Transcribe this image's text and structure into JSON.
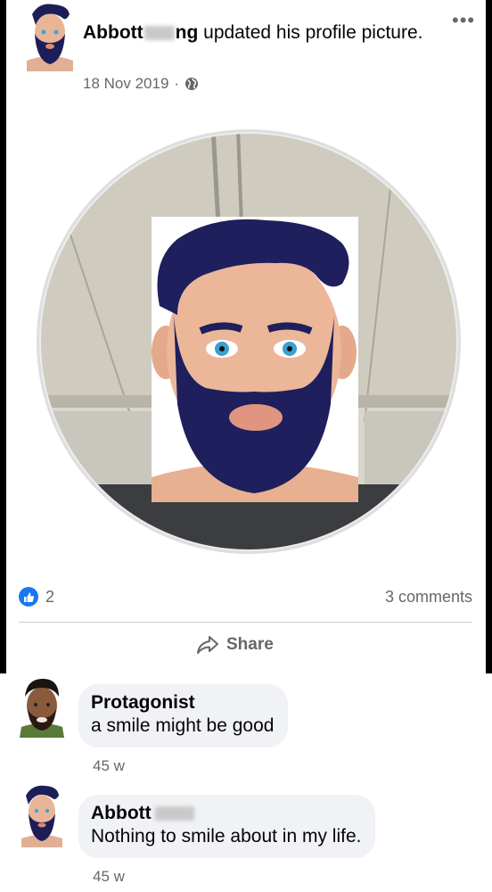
{
  "post": {
    "author_name": "Abbott",
    "author_name_suffix": "ng",
    "action_text": "updated his profile picture.",
    "date": "18 Nov 2019",
    "separator": "·",
    "more_label": "•••",
    "privacy_icon": "globe-icon"
  },
  "reactions": {
    "like_icon": "thumbs-up-icon",
    "like_count": "2",
    "comment_count_label": "3 comments"
  },
  "actions": {
    "share_label": "Share",
    "share_icon": "share-arrow-icon"
  },
  "comments": [
    {
      "author": "Protagonist",
      "text": "a smile might be good",
      "time": "45 w"
    },
    {
      "author": "Abbott",
      "text": "Nothing to smile about in my life.",
      "time": "45 w"
    }
  ],
  "colors": {
    "accent": "#1877f2",
    "secondary_text": "#65676b",
    "bubble": "#f0f2f5"
  }
}
